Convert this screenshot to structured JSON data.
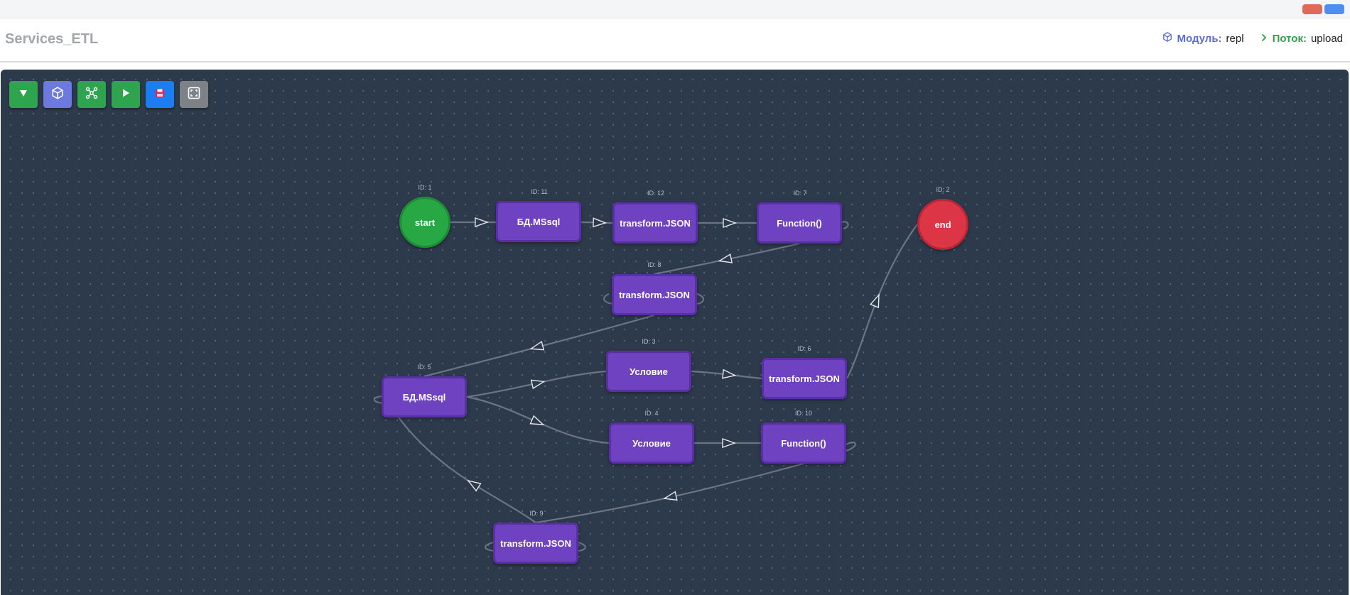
{
  "app": {
    "title": "Services_ETL"
  },
  "breadcrumb": {
    "module_label": "Модуль:",
    "module_value": "repl",
    "flow_label": "Поток:",
    "flow_value": "upload"
  },
  "toolbar": {
    "buttons": [
      {
        "name": "filter-button",
        "icon": "triangle-down-icon",
        "color": "#2ea44f"
      },
      {
        "name": "module-button",
        "icon": "cube-icon",
        "color": "#6c7ae0"
      },
      {
        "name": "graph-button",
        "icon": "network-icon",
        "color": "#2ea44f"
      },
      {
        "name": "run-button",
        "icon": "play-icon",
        "color": "#2ea44f"
      },
      {
        "name": "save-button",
        "icon": "floppy-icon",
        "color": "#1a7df0"
      },
      {
        "name": "fit-view-button",
        "icon": "expand-icon",
        "color": "#7d8287"
      }
    ]
  },
  "colors": {
    "canvas": "#2d3a4b",
    "node_purple": "#6f42c1",
    "start_green": "#28a745",
    "end_red": "#dc3545",
    "edge": "#6c7581"
  },
  "nodes": [
    {
      "key": "n1",
      "id_label": "ID: 1",
      "label": "start"
    },
    {
      "key": "n11",
      "id_label": "ID: 11",
      "label": "БД.MSsql"
    },
    {
      "key": "n12",
      "id_label": "ID: 12",
      "label": "transform.JSON"
    },
    {
      "key": "n7",
      "id_label": "ID: 7",
      "label": "Function()"
    },
    {
      "key": "n2",
      "id_label": "ID: 2",
      "label": "end"
    },
    {
      "key": "n8",
      "id_label": "ID: 8",
      "label": "transform.JSON"
    },
    {
      "key": "n5",
      "id_label": "ID: 5",
      "label": "БД.MSsql"
    },
    {
      "key": "n3",
      "id_label": "ID: 3",
      "label": "Условие"
    },
    {
      "key": "n6",
      "id_label": "ID: 6",
      "label": "transform.JSON"
    },
    {
      "key": "n4",
      "id_label": "ID: 4",
      "label": "Условие"
    },
    {
      "key": "n10",
      "id_label": "ID: 10",
      "label": "Function()"
    },
    {
      "key": "n9",
      "id_label": "ID: 9",
      "label": "transform.JSON"
    }
  ],
  "edges": [
    {
      "from": "n1",
      "to": "n11"
    },
    {
      "from": "n11",
      "to": "n12"
    },
    {
      "from": "n12",
      "to": "n7"
    },
    {
      "from": "n7",
      "to": "n8"
    },
    {
      "from": "n8",
      "to": "n5"
    },
    {
      "from": "n5",
      "to": "n3"
    },
    {
      "from": "n5",
      "to": "n4"
    },
    {
      "from": "n3",
      "to": "n6"
    },
    {
      "from": "n4",
      "to": "n10"
    },
    {
      "from": "n10",
      "to": "n9"
    },
    {
      "from": "n9",
      "to": "n5"
    },
    {
      "from": "n6",
      "to": "n2"
    }
  ]
}
